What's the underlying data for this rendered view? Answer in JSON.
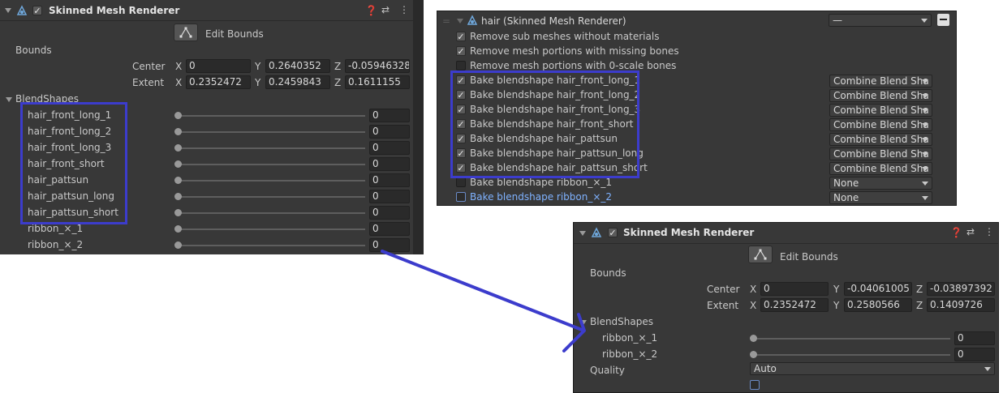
{
  "left": {
    "title": "Skinned Mesh Renderer",
    "edit_bounds": "Edit Bounds",
    "bounds_label": "Bounds",
    "center_label": "Center",
    "extent_label": "Extent",
    "center": {
      "x": "0",
      "y": "0.2640352",
      "z": "-0.05946328"
    },
    "extent": {
      "x": "0.2352472",
      "y": "0.2459843",
      "z": "0.1611155"
    },
    "blendshapes_label": "BlendShapes",
    "blendshapes": [
      {
        "name": "hair_front_long_1",
        "value": "0"
      },
      {
        "name": "hair_front_long_2",
        "value": "0"
      },
      {
        "name": "hair_front_long_3",
        "value": "0"
      },
      {
        "name": "hair_front_short",
        "value": "0"
      },
      {
        "name": "hair_pattsun",
        "value": "0"
      },
      {
        "name": "hair_pattsun_long",
        "value": "0"
      },
      {
        "name": "hair_pattsun_short",
        "value": "0"
      },
      {
        "name": "ribbon_×_1",
        "value": "0"
      },
      {
        "name": "ribbon_×_2",
        "value": "0"
      }
    ]
  },
  "middle": {
    "title": "hair (Skinned Mesh Renderer)",
    "header_dropdown": "—",
    "options": [
      {
        "label": "Remove sub meshes without materials",
        "checked": true
      },
      {
        "label": "Remove mesh portions with missing bones",
        "checked": true
      },
      {
        "label": "Remove mesh portions with 0-scale bones",
        "checked": false
      }
    ],
    "bake_rows": [
      {
        "label": "Bake blendshape hair_front_long_1",
        "checked": true,
        "mode": "Combine Blend Sha"
      },
      {
        "label": "Bake blendshape hair_front_long_2",
        "checked": true,
        "mode": "Combine Blend Sha"
      },
      {
        "label": "Bake blendshape hair_front_long_3",
        "checked": true,
        "mode": "Combine Blend Sha"
      },
      {
        "label": "Bake blendshape hair_front_short",
        "checked": true,
        "mode": "Combine Blend Sha"
      },
      {
        "label": "Bake blendshape hair_pattsun",
        "checked": true,
        "mode": "Combine Blend Sha"
      },
      {
        "label": "Bake blendshape hair_pattsun_long",
        "checked": true,
        "mode": "Combine Blend Sha"
      },
      {
        "label": "Bake blendshape hair_pattsun_short",
        "checked": true,
        "mode": "Combine Blend Sha"
      },
      {
        "label": "Bake blendshape ribbon_×_1",
        "checked": false,
        "mode": "None"
      },
      {
        "label": "Bake blendshape ribbon_×_2",
        "checked": false,
        "mode": "None"
      }
    ]
  },
  "bottom": {
    "title": "Skinned Mesh Renderer",
    "edit_bounds": "Edit Bounds",
    "bounds_label": "Bounds",
    "center_label": "Center",
    "extent_label": "Extent",
    "center": {
      "x": "0",
      "y": "-0.04061005",
      "z": "-0.03897392"
    },
    "extent": {
      "x": "0.2352472",
      "y": "0.2580566",
      "z": "0.1409726"
    },
    "blendshapes_label": "BlendShapes",
    "blendshapes": [
      {
        "name": "ribbon_×_1",
        "value": "0"
      },
      {
        "name": "ribbon_×_2",
        "value": "0"
      }
    ],
    "quality_label": "Quality",
    "quality_value": "Auto"
  },
  "axis": {
    "x": "X",
    "y": "Y",
    "z": "Z"
  },
  "colors": {
    "highlight": "#3c3ccc",
    "panel_bg": "#383838",
    "selected_text": "#7fb2ff"
  },
  "icons": [
    "help-icon",
    "preset-icon",
    "kebab-menu-icon",
    "edit-bounds-icon",
    "mesh-renderer-icon",
    "minus-icon"
  ]
}
